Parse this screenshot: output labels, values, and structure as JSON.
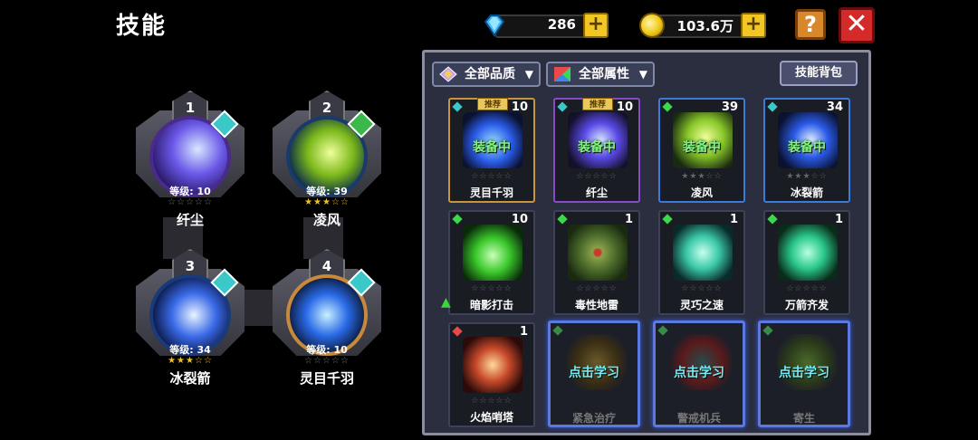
{
  "title": "技能",
  "currency": {
    "gems": "286",
    "gold": "103.6万",
    "plus": "+"
  },
  "buttons": {
    "help": "?",
    "close": "✕"
  },
  "equipped": [
    {
      "num": "1",
      "level": "等级: 10",
      "stars": "☆☆☆☆☆",
      "name": "纤尘"
    },
    {
      "num": "2",
      "level": "等级: 39",
      "stars": "★★★☆☆",
      "name": "凌风"
    },
    {
      "num": "3",
      "level": "等级: 34",
      "stars": "★★★☆☆",
      "name": "冰裂箭"
    },
    {
      "num": "4",
      "level": "等级: 10",
      "stars": "☆☆☆☆☆",
      "name": "灵目千羽"
    }
  ],
  "filters": {
    "quality": "全部品质",
    "attribute": "全部属性",
    "bag": "技能背包"
  },
  "cards": [
    {
      "count": "10",
      "tag": "推荐",
      "status": "装备中",
      "stars": "☆☆☆☆☆",
      "name": "灵目千羽"
    },
    {
      "count": "10",
      "tag": "推荐",
      "status": "装备中",
      "stars": "☆☆☆☆☆",
      "name": "纤尘"
    },
    {
      "count": "39",
      "status": "装备中",
      "stars": "★★★☆☆",
      "name": "凌风"
    },
    {
      "count": "34",
      "status": "装备中",
      "stars": "★★★☆☆",
      "name": "冰裂箭"
    },
    {
      "count": "10",
      "stars": "☆☆☆☆☆",
      "name": "暗影打击"
    },
    {
      "count": "1",
      "stars": "☆☆☆☆☆",
      "name": "毒性地雷"
    },
    {
      "count": "1",
      "stars": "☆☆☆☆☆",
      "name": "灵巧之速"
    },
    {
      "count": "1",
      "stars": "☆☆☆☆☆",
      "name": "万箭齐发"
    },
    {
      "count": "1",
      "stars": "☆☆☆☆☆",
      "name": "火焰哨塔"
    },
    {
      "learn": "点击学习",
      "name": "紧急治疗"
    },
    {
      "learn": "点击学习",
      "name": "警戒机兵"
    },
    {
      "learn": "点击学习",
      "name": "寄生"
    }
  ],
  "colors": {
    "accent_gold": "#f2c623",
    "close_red": "#d42a2a",
    "panel_bg": "#2a2e3e",
    "equipped_green": "#8af08a",
    "learn_cyan": "#7ae8f0"
  }
}
